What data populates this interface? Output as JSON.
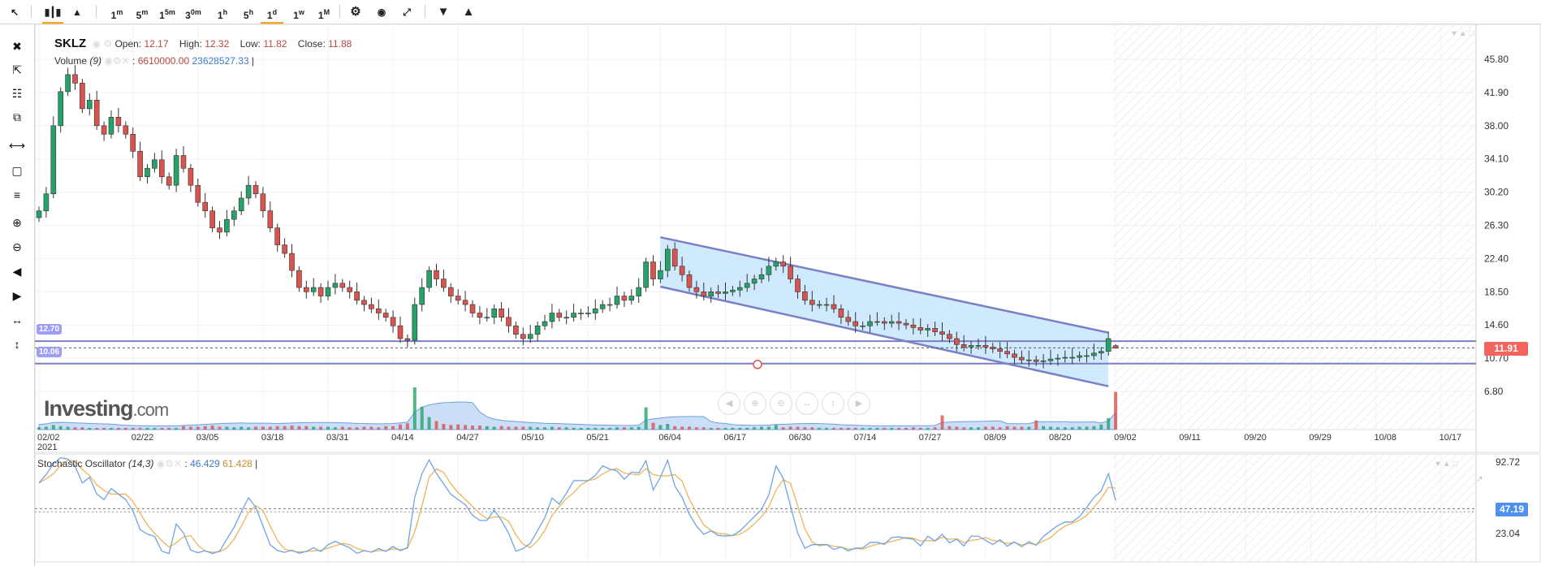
{
  "toolbar": {
    "intervals": [
      "1m",
      "5m",
      "15m",
      "30m",
      "1h",
      "5h",
      "1d",
      "1w",
      "1M"
    ],
    "active_interval": "1d",
    "icons": [
      "cursor-icon",
      "candlestick-icon",
      "area-chart-icon",
      "gear-icon",
      "camera-icon",
      "fullscreen-icon",
      "download-icon",
      "upload-icon"
    ]
  },
  "sidebar": {
    "icons": [
      "close-icon",
      "remove-drawings-icon",
      "remove-indicators-icon",
      "clone-icon",
      "line-tool-icon",
      "rectangle-tool-icon",
      "fib-tool-icon",
      "zoom-in-icon",
      "zoom-out-icon",
      "scroll-left-icon",
      "scroll-right-icon",
      "zoom-reset-icon",
      "zoom-fit-icon"
    ]
  },
  "legend": {
    "symbol": "SKLZ",
    "open_label": "Open:",
    "open": "12.17",
    "high_label": "High:",
    "high": "12.32",
    "low_label": "Low:",
    "low": "11.82",
    "close_label": "Close:",
    "close": "11.88",
    "volume_label": "Volume",
    "volume_param": "(9)",
    "volume_value": "6610000.00",
    "volume_ma": "23628527.33",
    "stoch_label": "Stochastic Oscillator",
    "stoch_param": "(14,3)",
    "stoch_k": "46.429",
    "stoch_d": "61.428"
  },
  "logo": {
    "name": "Investing",
    ".com": ".com"
  },
  "markers": {
    "price": "11.91",
    "stoch": "47.19",
    "level_upper": "12.70",
    "level_lower": "10.06"
  },
  "colors": {
    "up": "#26a269",
    "down": "#d9534f",
    "channel": "#7b7fc4",
    "channel_fill": "#bde3fb",
    "stoch_k": "#6fa3e8",
    "stoch_d": "#f0b35a",
    "price_marker": "#f4645f",
    "stoch_marker": "#4e8ff0"
  },
  "chart_data": {
    "type": "candlestick",
    "title": "SKLZ",
    "year_label": "2021",
    "yticks": [
      "45.80",
      "41.90",
      "38.00",
      "34.10",
      "30.20",
      "26.30",
      "22.40",
      "18.50",
      "14.60",
      "10.70",
      "6.80"
    ],
    "ylim": [
      6.8,
      45.8
    ],
    "date_ticks": [
      {
        "label": "02/02",
        "i": 0
      },
      {
        "label": "02/22",
        "i": 13
      },
      {
        "label": "03/05",
        "i": 22
      },
      {
        "label": "03/18",
        "i": 31
      },
      {
        "label": "03/31",
        "i": 40
      },
      {
        "label": "04/14",
        "i": 49
      },
      {
        "label": "04/27",
        "i": 58
      },
      {
        "label": "05/10",
        "i": 67
      },
      {
        "label": "05/21",
        "i": 76
      },
      {
        "label": "06/04",
        "i": 86
      },
      {
        "label": "06/17",
        "i": 95
      },
      {
        "label": "06/30",
        "i": 104
      },
      {
        "label": "07/14",
        "i": 113
      },
      {
        "label": "07/27",
        "i": 122
      },
      {
        "label": "08/09",
        "i": 131
      },
      {
        "label": "08/20",
        "i": 140
      },
      {
        "label": "09/02",
        "i": 149
      },
      {
        "label": "09/11",
        "i": 158
      },
      {
        "label": "09/20",
        "i": 167
      },
      {
        "label": "09/29",
        "i": 176
      },
      {
        "label": "10/08",
        "i": 185
      },
      {
        "label": "10/17",
        "i": 194
      }
    ],
    "close": [
      28,
      30,
      38,
      42,
      44,
      43,
      40,
      41,
      38,
      37,
      39,
      38,
      37,
      35,
      32,
      33,
      34,
      32,
      31,
      34.5,
      33,
      31,
      29,
      28,
      26,
      25.5,
      27,
      28,
      29.5,
      31,
      30,
      28,
      26,
      24,
      23,
      21,
      19,
      18.5,
      19,
      18,
      19,
      19.5,
      19,
      18.5,
      17.5,
      17,
      16.5,
      16,
      15.5,
      14.5,
      13,
      12.8,
      17,
      19,
      21,
      20,
      19,
      18,
      17.5,
      17,
      16,
      15.5,
      15.5,
      16.5,
      15.5,
      14.5,
      13.5,
      13,
      13.5,
      14.5,
      15,
      16,
      15.5,
      15.5,
      16,
      16,
      16,
      16.5,
      17,
      17,
      18,
      17.5,
      18,
      19,
      22,
      20,
      21,
      23.5,
      21.5,
      20.5,
      19,
      18.5,
      18,
      18.5,
      18.3,
      18.5,
      18.7,
      19,
      19.5,
      20,
      20.5,
      21.5,
      22,
      21.5,
      20,
      18.5,
      17.5,
      17,
      17,
      17,
      16.5,
      15.5,
      15,
      14.5,
      14.5,
      15,
      15,
      14.8,
      15,
      14.8,
      14.6,
      14.3,
      14,
      14.2,
      13.8,
      13.5,
      13,
      12.3,
      12,
      12.2,
      12.2,
      12,
      11.8,
      11.5,
      11.2,
      10.8,
      10.5,
      10.5,
      10.3,
      10.4,
      10.6,
      10.7,
      10.8,
      10.8,
      11,
      11,
      11.3,
      11.5,
      13,
      11.88
    ],
    "volume_millions": [
      0.4,
      0.5,
      0.8,
      0.6,
      0.5,
      0.4,
      0.4,
      0.3,
      0.3,
      0.3,
      0.3,
      0.3,
      0.3,
      0.3,
      0.3,
      0.3,
      0.3,
      0.3,
      0.3,
      0.3,
      0.6,
      0.5,
      0.5,
      0.6,
      0.7,
      0.5,
      0.5,
      0.4,
      0.5,
      0.4,
      0.5,
      0.5,
      0.5,
      0.6,
      0.6,
      0.7,
      0.6,
      0.6,
      0.5,
      0.5,
      0.5,
      0.4,
      0.5,
      0.4,
      0.4,
      0.5,
      0.5,
      0.4,
      0.6,
      0.6,
      0.9,
      1.1,
      7.4,
      4.0,
      2.2,
      1.5,
      1.0,
      0.8,
      0.9,
      0.8,
      0.7,
      0.7,
      0.6,
      0.5,
      0.6,
      0.5,
      0.5,
      0.5,
      0.5,
      0.4,
      0.4,
      0.5,
      0.4,
      0.4,
      0.3,
      0.3,
      0.3,
      0.3,
      0.3,
      0.3,
      0.4,
      0.4,
      0.4,
      0.5,
      3.9,
      1.2,
      0.8,
      1.0,
      0.6,
      0.5,
      0.5,
      0.4,
      0.4,
      0.3,
      0.3,
      0.3,
      0.3,
      0.3,
      0.3,
      0.4,
      0.5,
      0.5,
      0.8,
      0.4,
      0.5,
      0.5,
      0.4,
      0.4,
      0.3,
      0.3,
      0.3,
      0.3,
      0.3,
      0.3,
      0.3,
      0.3,
      0.3,
      0.3,
      0.3,
      0.3,
      0.3,
      0.4,
      0.3,
      0.3,
      0.4,
      2.5,
      0.6,
      0.5,
      0.4,
      0.4,
      0.4,
      0.5,
      0.5,
      0.4,
      0.6,
      0.5,
      0.5,
      0.5,
      1.6,
      0.6,
      0.5,
      0.4,
      0.4,
      0.4,
      0.5,
      0.5,
      0.6,
      0.9,
      2.0,
      6.6
    ],
    "channel": {
      "upper": [
        [
          86,
          24.9
        ],
        [
          148,
          13.7
        ]
      ],
      "lower": [
        [
          86,
          19.1
        ],
        [
          148,
          7.4
        ]
      ]
    },
    "levels": [
      12.7,
      10.06
    ],
    "current_price": 11.91,
    "stoch": {
      "yticks": [
        "92.72",
        "23.04"
      ],
      "ylim": [
        0,
        100
      ],
      "current": 47.19,
      "period": 14,
      "smooth": 3
    }
  }
}
